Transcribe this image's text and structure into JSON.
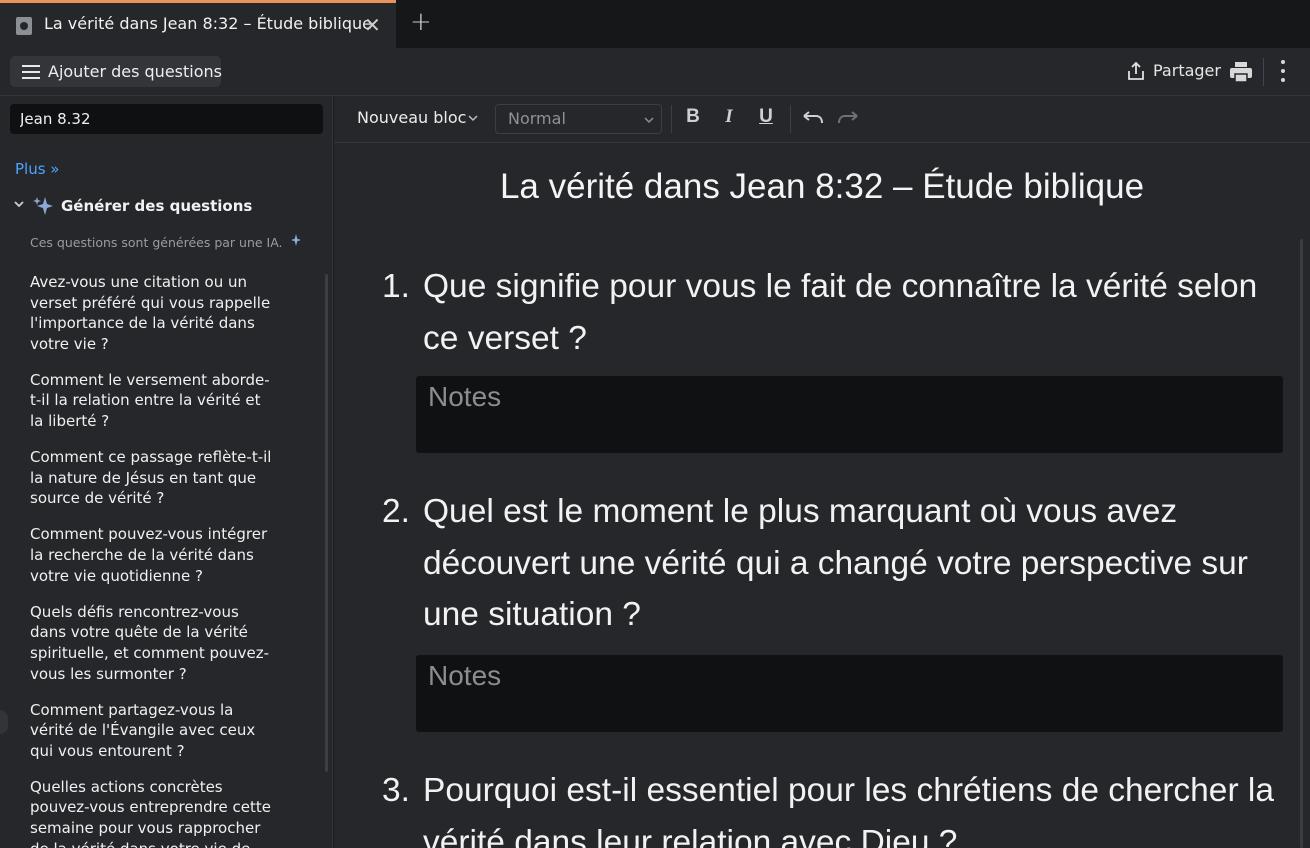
{
  "tab": {
    "title": "La vérité dans Jean 8:32 – Étude biblique",
    "close": "✕",
    "add": "+"
  },
  "topbar": {
    "add_questions": "Ajouter des questions",
    "share": "Partager"
  },
  "sidebar": {
    "search_value": "Jean 8.32",
    "more_link": "Plus »",
    "generate_label": "Générer des questions",
    "ai_note": "Ces questions sont générées par une IA.",
    "questions": [
      "Avez-vous une citation ou un verset préféré qui vous rappelle l'importance de la vérité dans votre vie ?",
      "Comment le versement aborde-t-il la relation entre la vérité et la liberté ?",
      "Comment ce passage reflète-t-il la nature de Jésus en tant que source de vérité ?",
      "Comment pouvez-vous intégrer la recherche de la vérité dans votre vie quotidienne ?",
      "Quels défis rencontrez-vous dans votre quête de la vérité spirituelle, et comment pouvez-vous les surmonter ?",
      "Comment partagez-vous la vérité de l'Évangile avec ceux qui vous entourent ?",
      "Quelles actions concrètes pouvez-vous entreprendre cette semaine pour vous rapprocher de la vérité dans votre vie de"
    ]
  },
  "editor_toolbar": {
    "block_type": "Nouveau bloc",
    "style": "Normal",
    "bold": "B",
    "italic": "I",
    "underline": "U"
  },
  "document": {
    "title": "La vérité dans Jean 8:32 – Étude biblique",
    "notes_placeholder": "Notes",
    "questions": [
      {
        "num": "1.",
        "text": "Que signifie pour vous le fait de connaître la vérité selon ce verset ?"
      },
      {
        "num": "2.",
        "text": "Quel est le moment le plus marquant où vous avez découvert une vérité qui a changé votre perspective sur une situation ?"
      },
      {
        "num": "3.",
        "text": "Pourquoi est-il essentiel pour les chrétiens de chercher la vérité dans leur relation avec Dieu ?"
      }
    ]
  },
  "colors": {
    "accent_tab": "#e8935a",
    "link": "#4ea3ff",
    "background": "#26272b",
    "notes_bg": "#101113"
  }
}
